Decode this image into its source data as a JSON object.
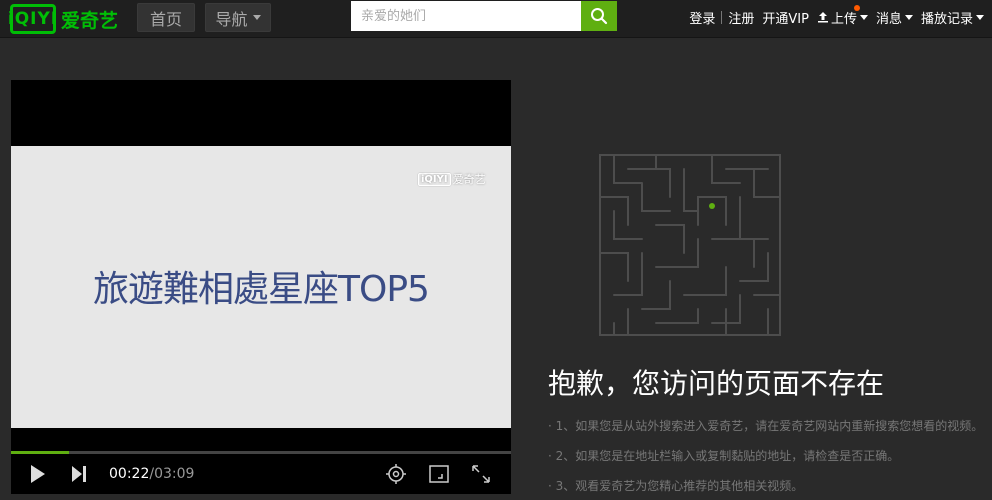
{
  "header": {
    "logo_mark": "iQIYI",
    "logo_text": "爱奇艺",
    "home_label": "首页",
    "nav_label": "导航",
    "search_placeholder": "亲爱的她们",
    "links": [
      "登录",
      "注册",
      "开通VIP",
      "上传",
      "消息",
      "播放记录"
    ],
    "accent": "#5faf11",
    "brand_green": "#00be06"
  },
  "player": {
    "video_title": "旅遊難相處星座TOP5",
    "watermark_mark": "iQIYI",
    "watermark_text": "爱奇艺",
    "time_current": "00:22",
    "time_total": "/03:09",
    "progress": 0.116
  },
  "error": {
    "title": "抱歉，您访问的页面不存在",
    "tips": [
      "1、如果您是从站外搜索进入爱奇艺，请在爱奇艺网站内重新搜索您想看的视频。",
      "2、如果您是在地址栏输入或复制黏贴的地址，请检查是否正确。",
      "3、观看爱奇艺为您精心推荐的其他相关视频。"
    ]
  }
}
